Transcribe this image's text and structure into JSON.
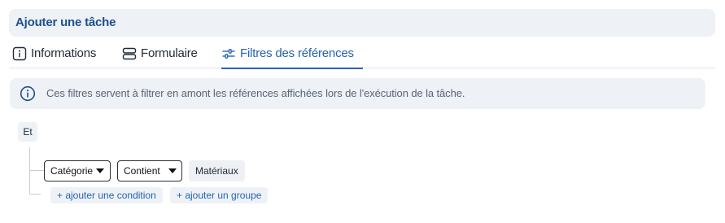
{
  "header": {
    "title": "Ajouter une tâche"
  },
  "tabs": [
    {
      "label": "Informations",
      "icon": "info-icon",
      "active": false
    },
    {
      "label": "Formulaire",
      "icon": "form-rows-icon",
      "active": false
    },
    {
      "label": "Filtres des références",
      "icon": "sliders-icon",
      "active": true
    }
  ],
  "info": {
    "icon": "info-icon",
    "text": "Ces filtres servent à filtrer en amont les références affichées lors de l'exécution de la tâche."
  },
  "filter": {
    "logic": "Et",
    "condition": {
      "field": "Catégorie",
      "operator": "Contient",
      "value": "Matériaux"
    },
    "add_condition_label": "+ ajouter une condition",
    "add_group_label": "+ ajouter un groupe"
  },
  "colors": {
    "accent": "#2562b5",
    "title": "#1e4f8f",
    "panel_bg": "#eef2f7"
  }
}
